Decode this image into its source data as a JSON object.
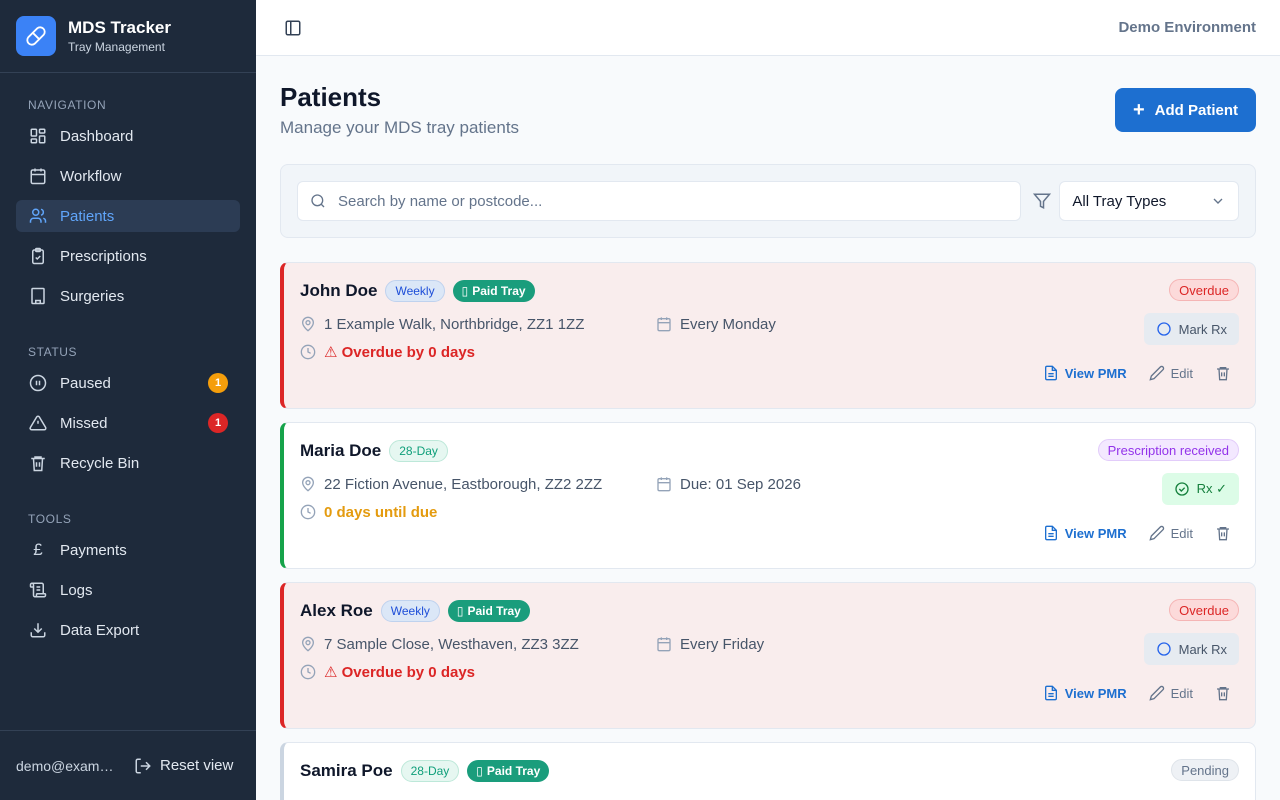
{
  "brand": {
    "title": "MDS Tracker",
    "subtitle": "Tray Management"
  },
  "sidebar": {
    "nav_label": "NAVIGATION",
    "nav": [
      {
        "label": "Dashboard",
        "icon": "dashboard-icon"
      },
      {
        "label": "Workflow",
        "icon": "calendar-icon"
      },
      {
        "label": "Patients",
        "icon": "users-icon",
        "active": true
      },
      {
        "label": "Prescriptions",
        "icon": "clipboard-icon"
      },
      {
        "label": "Surgeries",
        "icon": "building-icon"
      }
    ],
    "status_label": "STATUS",
    "status": [
      {
        "label": "Paused",
        "icon": "pause-icon",
        "count": "1",
        "color": "#f59e0b"
      },
      {
        "label": "Missed",
        "icon": "alert-icon",
        "count": "1",
        "color": "#dc2626"
      },
      {
        "label": "Recycle Bin",
        "icon": "trash-icon"
      }
    ],
    "tools_label": "TOOLS",
    "tools": [
      {
        "label": "Payments",
        "icon": "pound-icon",
        "glyph": "£"
      },
      {
        "label": "Logs",
        "icon": "logs-icon"
      },
      {
        "label": "Data Export",
        "icon": "download-icon"
      }
    ],
    "footer": {
      "email": "demo@example.com",
      "reset_label": "Reset view"
    }
  },
  "topbar": {
    "environment": "Demo Environment"
  },
  "page": {
    "title": "Patients",
    "subtitle": "Manage your MDS tray patients",
    "add_label": "Add Patient"
  },
  "filters": {
    "search_placeholder": "Search by name or postcode...",
    "tray_type": "All Tray Types"
  },
  "patients": [
    {
      "name": "John Doe",
      "frequency": "Weekly",
      "paid": "Paid Tray",
      "status": "Overdue",
      "address": "1 Example Walk, Northbridge, ZZ1 1ZZ",
      "schedule": "Every Monday",
      "due": "⚠ Overdue by 0 days",
      "rx": "Mark Rx"
    },
    {
      "name": "Maria Doe",
      "frequency": "28-Day",
      "status": "Prescription received",
      "address": "22 Fiction Avenue, Eastborough, ZZ2 2ZZ",
      "schedule": "Due: 01 Sep 2026",
      "due": "0 days until due",
      "rx": "Rx ✓"
    },
    {
      "name": "Alex Roe",
      "frequency": "Weekly",
      "paid": "Paid Tray",
      "status": "Overdue",
      "address": "7 Sample Close, Westhaven, ZZ3 3ZZ",
      "schedule": "Every Friday",
      "due": "⚠ Overdue by 0 days",
      "rx": "Mark Rx"
    },
    {
      "name": "Samira Poe",
      "frequency": "28-Day",
      "paid": "Paid Tray",
      "status": "Pending"
    }
  ],
  "card_actions": {
    "pmr": "View PMR",
    "edit": "Edit"
  }
}
